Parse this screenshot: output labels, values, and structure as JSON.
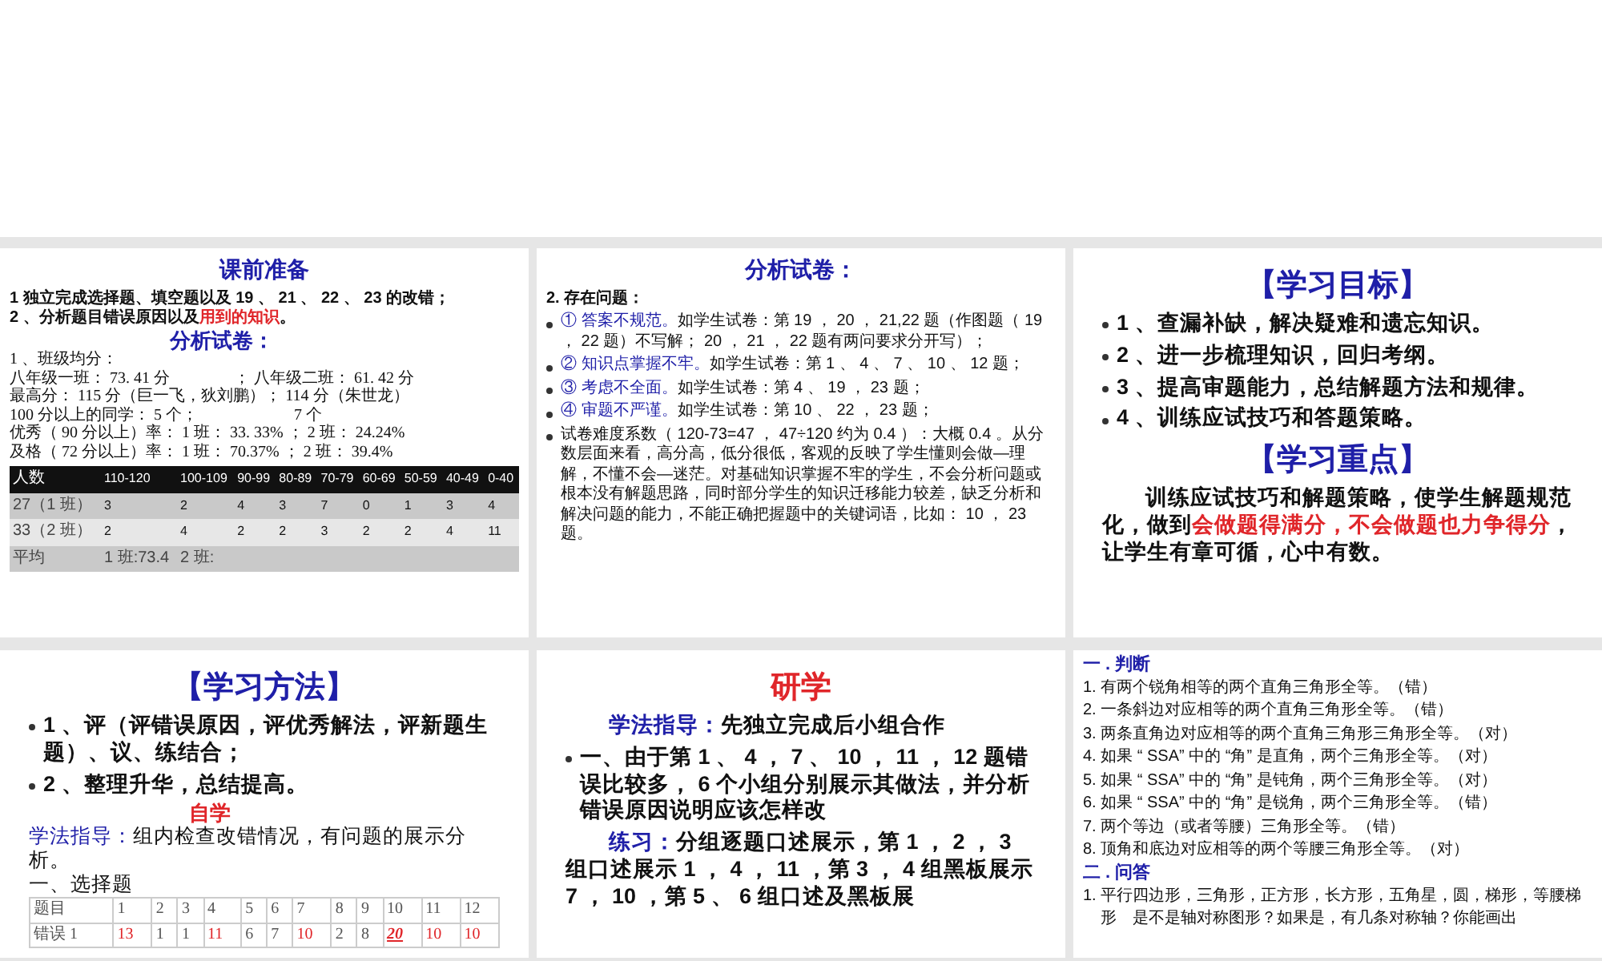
{
  "slides": [
    {
      "kind": "small-print",
      "blocks": [
        {
          "kind": "heading",
          "runs": [
            {
              "text": "课前准备",
              "color": "#1f1fa8"
            }
          ]
        },
        {
          "kind": "line",
          "bold": true,
          "runs": [
            {
              "text": "1 独立完成选择题、填空题以及 19 、 21 、 22 、 23 的改错；"
            }
          ]
        },
        {
          "kind": "line",
          "bold": true,
          "runs": [
            {
              "text": "2 、分析题目错误原因以及"
            },
            {
              "text": "用到的知识",
              "color": "#e0262a"
            },
            {
              "text": "。"
            }
          ]
        },
        {
          "kind": "subheading",
          "runs": [
            {
              "text": "分析试卷：",
              "color": "#1f1fa8"
            }
          ]
        },
        {
          "kind": "serif-line",
          "runs": [
            {
              "text": "1 、班级均分："
            }
          ]
        },
        {
          "kind": "serif-line",
          "runs": [
            {
              "text": "八年级一班： 73. 41 分　　　　；  八年级二班： 61. 42 分"
            }
          ]
        },
        {
          "kind": "serif-line",
          "runs": [
            {
              "text": "最高分： 115 分（巨一飞，狄刘鹏）； 114 分（朱世龙）"
            }
          ]
        },
        {
          "kind": "serif-line",
          "runs": [
            {
              "text": "100 分以上的同学： 5 个；　　　　　　7 个"
            }
          ]
        },
        {
          "kind": "serif-line",
          "runs": [
            {
              "text": "优秀（ 90 分以上）率： 1 班： 33. 33% ； 2 班： 24.24%"
            }
          ]
        },
        {
          "kind": "serif-line",
          "runs": [
            {
              "text": "及格（ 72 分以上）率： 1 班： 70.37% ； 2 班： 39.4%"
            }
          ]
        },
        {
          "kind": "score-table",
          "columns": [
            "人数",
            "110-120",
            "100-109",
            "90-99",
            "80-89",
            "70-79",
            "60-69",
            "50-59",
            "40-49",
            "0-40"
          ],
          "rows": [
            [
              "27（1 班）",
              "3",
              "2",
              "4",
              "3",
              "7",
              "0",
              "1",
              "3",
              "4"
            ],
            [
              "33（2 班）",
              "2",
              "4",
              "2",
              "2",
              "3",
              "2",
              "2",
              "4",
              "11"
            ],
            [
              "平均",
              "1 班:73.4",
              "2 班:",
              "",
              "",
              "",
              "",
              "",
              "",
              ""
            ]
          ]
        }
      ]
    },
    {
      "kind": "small-print",
      "blocks": [
        {
          "kind": "heading",
          "runs": [
            {
              "text": "分析试卷：",
              "color": "#1f1fa8"
            }
          ]
        },
        {
          "kind": "line",
          "bold": true,
          "runs": [
            {
              "text": "2. 存在问题："
            }
          ]
        },
        {
          "kind": "bullet",
          "runs": [
            {
              "text": "① 答案不规范。",
              "color": "#1f1fa8"
            },
            {
              "text": "如学生试卷：第 19 ， 20 ， 21,22 题（作图题（ 19 ， 22 题）不写解； 20 ， 21 ， 22 题有两问要求分开写）；"
            }
          ]
        },
        {
          "kind": "bullet",
          "runs": [
            {
              "text": "② 知识点掌握不牢。",
              "color": "#1f1fa8"
            },
            {
              "text": "如学生试卷：第 1 、 4 、 7 、 10 、 12 题；"
            }
          ]
        },
        {
          "kind": "bullet",
          "runs": [
            {
              "text": "③ 考虑不全面。",
              "color": "#1f1fa8"
            },
            {
              "text": "如学生试卷：第 4 、 19 ， 23 题；"
            }
          ]
        },
        {
          "kind": "bullet",
          "runs": [
            {
              "text": "④ 审题不严谨。",
              "color": "#1f1fa8"
            },
            {
              "text": "如学生试卷：第 10 、 22 ， 23 题；"
            }
          ]
        },
        {
          "kind": "bullet",
          "runs": [
            {
              "text": "试卷难度系数（ 120-73=47 ， 47÷120 约为 0.4 ）：大概 0.4 。从分数层面来看，高分高，低分很低，客观的反映了学生懂则会做—理解，不懂不会—迷茫。对基础知识掌握不牢的学生，不会分析问题或根本没有解题思路，同时部分学生的知识迁移能力较差，缺乏分析和解决问题的能力，不能正确把握题中的关键词语，比如： 10 ， 23 题。"
            }
          ]
        }
      ]
    },
    {
      "kind": "large-print",
      "blocks": [
        {
          "kind": "heading",
          "runs": [
            {
              "text": "【学习目标】",
              "color": "#1f1fa8"
            }
          ]
        },
        {
          "kind": "bullet",
          "runs": [
            {
              "text": "1 、查漏补缺，解决疑难和遗忘知识。"
            }
          ]
        },
        {
          "kind": "bullet",
          "runs": [
            {
              "text": "2 、进一步梳理知识，回归考纲。"
            }
          ]
        },
        {
          "kind": "bullet",
          "runs": [
            {
              "text": "3 、提高审题能力，总结解题方法和规律。"
            }
          ]
        },
        {
          "kind": "bullet",
          "runs": [
            {
              "text": "4 、训练应试技巧和答题策略。"
            }
          ]
        },
        {
          "kind": "heading",
          "runs": [
            {
              "text": "【学习重点】",
              "color": "#1f1fa8"
            }
          ]
        },
        {
          "kind": "para",
          "runs": [
            {
              "text": "训练应试技巧和解题策略，使学生解题规范化，做到"
            },
            {
              "text": "会做题得满分，不会做题也力争得分",
              "color": "#e0262a"
            },
            {
              "text": "，让学生有章可循，心中有数。"
            }
          ]
        }
      ]
    },
    {
      "kind": "large-print",
      "blocks": [
        {
          "kind": "heading",
          "runs": [
            {
              "text": "【学习方法】",
              "color": "#1f1fa8"
            }
          ]
        },
        {
          "kind": "bullet",
          "runs": [
            {
              "text": "1 、评（评错误原因，评优秀解法，评新题生题）、议、练结合；"
            }
          ]
        },
        {
          "kind": "bullet",
          "runs": [
            {
              "text": "2 、整理升华，总结提高。"
            }
          ]
        },
        {
          "kind": "subheading",
          "runs": [
            {
              "text": "自学",
              "color": "#e0262a"
            }
          ]
        },
        {
          "kind": "line",
          "bold": false,
          "runs": [
            {
              "text": "学法指导：",
              "color": "#1f1fa8"
            },
            {
              "text": "组内检查改错情况，有问题的展示分析。"
            }
          ]
        },
        {
          "kind": "line",
          "bold": false,
          "runs": [
            {
              "text": "一、选择题"
            }
          ]
        },
        {
          "kind": "grid-table",
          "columns": [
            "题目",
            "1",
            "2",
            "3",
            "4",
            "5",
            "6",
            "7",
            "8",
            "9",
            "10",
            "11",
            "12"
          ],
          "rows": [
            [
              {
                "text": "错误 1",
                "emphasis": false
              },
              {
                "text": "13",
                "color": "#e0262a",
                "emphasis": false
              },
              {
                "text": "1",
                "emphasis": false
              },
              {
                "text": "1",
                "emphasis": false
              },
              {
                "text": "11",
                "color": "#e0262a",
                "emphasis": false
              },
              {
                "text": "6",
                "emphasis": false
              },
              {
                "text": "7",
                "emphasis": false
              },
              {
                "text": "10",
                "color": "#e0262a",
                "emphasis": false
              },
              {
                "text": "2",
                "emphasis": false
              },
              {
                "text": "8",
                "emphasis": false
              },
              {
                "text": "20",
                "color": "#e0262a",
                "emphasis": true
              },
              {
                "text": "10",
                "color": "#e0262a",
                "emphasis": false
              },
              {
                "text": "10",
                "color": "#e0262a",
                "emphasis": false
              }
            ]
          ]
        }
      ]
    },
    {
      "kind": "large-print",
      "blocks": [
        {
          "kind": "heading",
          "runs": [
            {
              "text": "研学",
              "color": "#e0262a"
            }
          ]
        },
        {
          "kind": "para",
          "runs": [
            {
              "text": "学法指导：",
              "color": "#1f1fa8"
            },
            {
              "text": "先独立完成后小组合作"
            }
          ]
        },
        {
          "kind": "bullet",
          "runs": [
            {
              "text": "一、由于第 1 、 4 ， 7 、 10 ， 11 ， 12 题错误比较多， 6 个小组分别展示其做法，并分析错误原因说明应该怎样改"
            }
          ]
        },
        {
          "kind": "para",
          "runs": [
            {
              "text": "练习：",
              "color": "#1f1fa8"
            },
            {
              "text": "分组逐题口述展示，第 1 ， 2 ， 3 组口述展示 1 ， 4 ， 11 ，第 3 ， 4 组黑板展示 7 ， 10 ，第 5 、 6 组口述及黑板展"
            }
          ]
        }
      ]
    },
    {
      "kind": "small-print",
      "blocks": [
        {
          "kind": "section",
          "runs": [
            {
              "text": "一 . 判断",
              "color": "#1f1fa8"
            }
          ]
        },
        {
          "kind": "item",
          "runs": [
            {
              "text": "1. 有两个锐角相等的两个直角三角形全等。（错）"
            }
          ]
        },
        {
          "kind": "item",
          "runs": [
            {
              "text": "2. 一条斜边对应相等的两个直角三角形全等。（错）"
            }
          ]
        },
        {
          "kind": "item",
          "runs": [
            {
              "text": "3. 两条直角边对应相等的两个直角三角形三角形全等。（对）"
            }
          ]
        },
        {
          "kind": "item",
          "runs": [
            {
              "text": "4. 如果 “ SSA” 中的 “角” 是直角，两个三角形全等。（对）"
            }
          ]
        },
        {
          "kind": "item",
          "runs": [
            {
              "text": "5. 如果 “ SSA” 中的 “角” 是钝角，两个三角形全等。（对）"
            }
          ]
        },
        {
          "kind": "item",
          "runs": [
            {
              "text": "6. 如果 “ SSA” 中的 “角” 是锐角，两个三角形全等。（错）"
            }
          ]
        },
        {
          "kind": "item",
          "runs": [
            {
              "text": "7. 两个等边（或者等腰）三角形全等。（错）"
            }
          ]
        },
        {
          "kind": "item",
          "runs": [
            {
              "text": "8. 顶角和底边对应相等的两个等腰三角形全等。（对）"
            }
          ]
        },
        {
          "kind": "section",
          "runs": [
            {
              "text": "二 . 问答",
              "color": "#1f1fa8"
            }
          ]
        },
        {
          "kind": "item",
          "runs": [
            {
              "text": "1. 平行四边形，三角形，正方形，长方形，五角星，圆，梯形，等腰梯形　是不是轴对称图形？如果是，有几条对称轴？你能画出"
            }
          ]
        }
      ]
    }
  ]
}
